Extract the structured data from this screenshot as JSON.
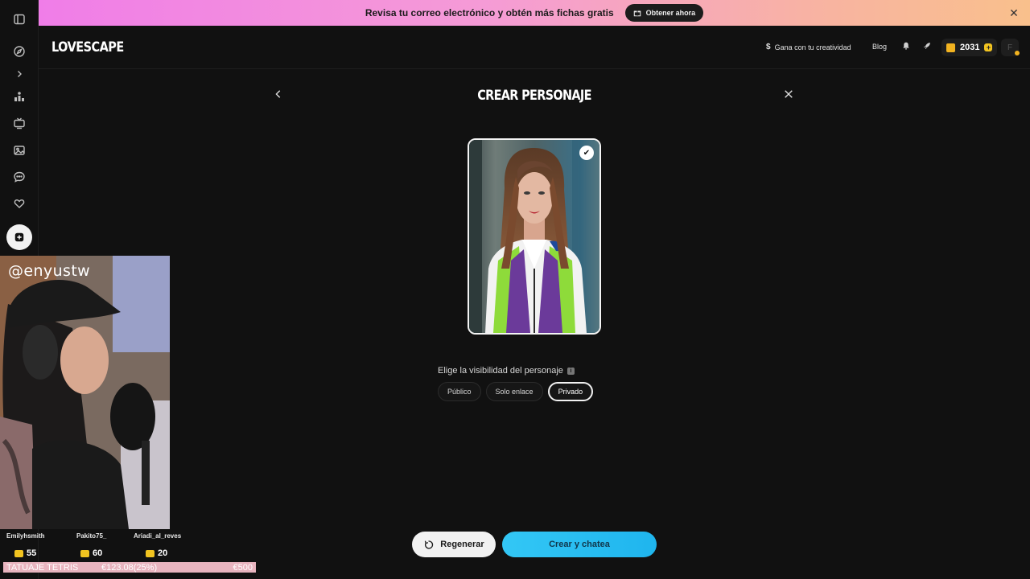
{
  "banner": {
    "text": "Revisa tu correo electrónico y obtén más fichas gratis",
    "button_label": "Obtener ahora"
  },
  "header": {
    "logo": "LOVESCAPE",
    "earn_label": "Gana con tu creatividad",
    "blog_label": "Blog",
    "coin_balance": "2031",
    "avatar_initial": "F"
  },
  "sidebar": {
    "icons": [
      "panel-toggle-icon",
      "compass-icon",
      "chevron-right-icon",
      "leaderboard-icon",
      "tv-icon",
      "gallery-icon",
      "chat-icon",
      "heart-hands-icon",
      "add-icon"
    ]
  },
  "main": {
    "title": "CREAR PERSONAJE",
    "visibility_label": "Elige la visibilidad del personaje",
    "visibility_options": [
      "Público",
      "Solo enlace",
      "Privado"
    ],
    "selected_visibility": "Privado",
    "regen_label": "Regenerar",
    "create_label": "Crear y chatea"
  },
  "stream": {
    "handle": "@enyustw",
    "donors": [
      {
        "name": "Emilyhsmith",
        "amount": "55"
      },
      {
        "name": "Pakito75_",
        "amount": "60"
      },
      {
        "name": "Ariadi_al_reves",
        "amount": "20"
      }
    ],
    "goal": {
      "name": "TATUAJE TETRIS",
      "progress": "€123.08(25%)",
      "target": "€500",
      "progress_fraction": 0.25
    }
  }
}
